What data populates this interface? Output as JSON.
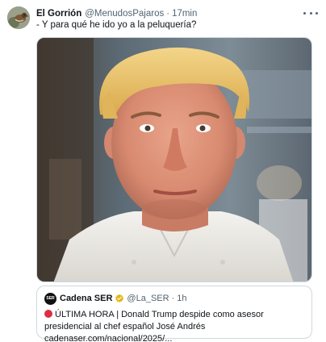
{
  "tweet": {
    "author_name": "El Gorrión",
    "handle": "@MenudosPajaros",
    "separator": "·",
    "time": "17min",
    "text": "- Y para qué he ido yo a la peluquería?",
    "media_icon": "chef-portrait-image"
  },
  "quote": {
    "avatar_text": "SER",
    "name": "Cadena SER",
    "handle": "@La_SER",
    "separator": "·",
    "time": "1h",
    "alert_icon": "red-circle-icon",
    "body": "ÚLTIMA HORA | Donald Trump despide como asesor presidencial al chef español José Andrés cadenaser.com/nacional/2025/..."
  },
  "colors": {
    "text_primary": "#0f1419",
    "text_secondary": "#536471",
    "border": "#cfd9de",
    "verified_gold": "#e2b719",
    "alert_red": "#dd2e44"
  }
}
